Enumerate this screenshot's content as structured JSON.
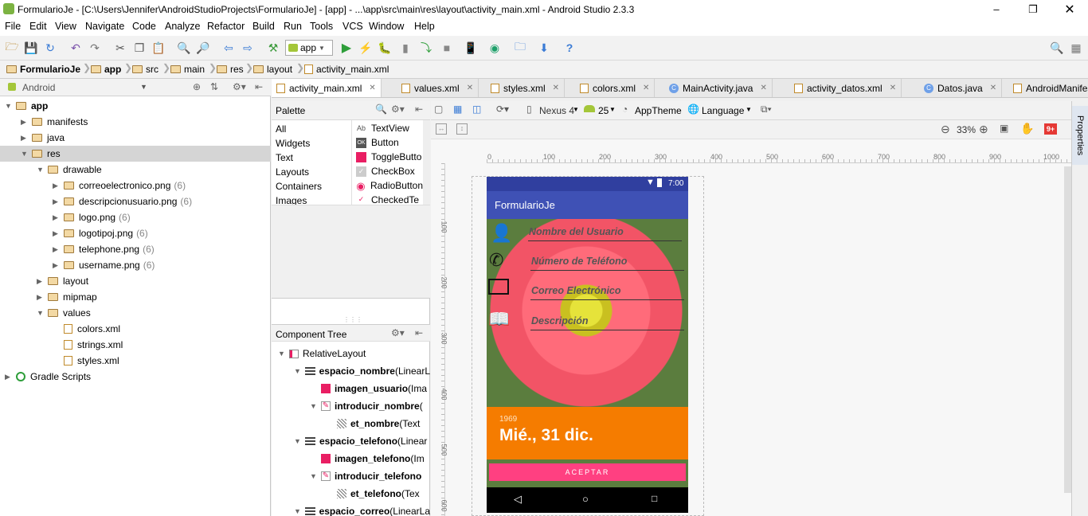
{
  "window": {
    "title": "FormularioJe - [C:\\Users\\Jennifer\\AndroidStudioProjects\\FormularioJe] - [app] - ...\\app\\src\\main\\res\\layout\\activity_main.xml - Android Studio 2.3.3"
  },
  "menu": [
    "File",
    "Edit",
    "View",
    "Navigate",
    "Code",
    "Analyze",
    "Refactor",
    "Build",
    "Run",
    "Tools",
    "VCS",
    "Window",
    "Help"
  ],
  "toolbar": {
    "run_config": "app"
  },
  "breadcrumb": [
    "FormularioJe",
    "app",
    "src",
    "main",
    "res",
    "layout",
    "activity_main.xml"
  ],
  "project": {
    "view_mode": "Android",
    "tree": [
      {
        "label": "app",
        "depth": 0,
        "bold": true,
        "type": "module",
        "expanded": true
      },
      {
        "label": "manifests",
        "depth": 1,
        "type": "folder",
        "arrow": "▶"
      },
      {
        "label": "java",
        "depth": 1,
        "type": "folder",
        "arrow": "▶"
      },
      {
        "label": "res",
        "depth": 1,
        "type": "folder",
        "arrow": "▼",
        "selected": true
      },
      {
        "label": "drawable",
        "depth": 2,
        "type": "folder",
        "arrow": "▼"
      },
      {
        "label": "correoelectronico.png",
        "depth": 3,
        "type": "folder",
        "arrow": "▶",
        "count": "(6)"
      },
      {
        "label": "descripcionusuario.png",
        "depth": 3,
        "type": "folder",
        "arrow": "▶",
        "count": "(6)"
      },
      {
        "label": "logo.png",
        "depth": 3,
        "type": "folder",
        "arrow": "▶",
        "count": "(6)"
      },
      {
        "label": "logotipoj.png",
        "depth": 3,
        "type": "folder",
        "arrow": "▶",
        "count": "(6)"
      },
      {
        "label": "telephone.png",
        "depth": 3,
        "type": "folder",
        "arrow": "▶",
        "count": "(6)"
      },
      {
        "label": "username.png",
        "depth": 3,
        "type": "folder",
        "arrow": "▶",
        "count": "(6)"
      },
      {
        "label": "layout",
        "depth": 2,
        "type": "folder",
        "arrow": "▶"
      },
      {
        "label": "mipmap",
        "depth": 2,
        "type": "folder",
        "arrow": "▶"
      },
      {
        "label": "values",
        "depth": 2,
        "type": "folder",
        "arrow": "▼"
      },
      {
        "label": "colors.xml",
        "depth": 3,
        "type": "file"
      },
      {
        "label": "strings.xml",
        "depth": 3,
        "type": "file"
      },
      {
        "label": "styles.xml",
        "depth": 3,
        "type": "file"
      },
      {
        "label": "Gradle Scripts",
        "depth": 0,
        "type": "gradle",
        "arrow": "▶"
      }
    ]
  },
  "tabs": [
    {
      "label": "activity_main.xml",
      "active": true,
      "icon": "layout-icon"
    },
    {
      "label": "values.xml",
      "icon": "xml-icon"
    },
    {
      "label": "styles.xml",
      "icon": "xml-icon"
    },
    {
      "label": "colors.xml",
      "icon": "xml-icon"
    },
    {
      "label": "MainActivity.java",
      "icon": "class-icon"
    },
    {
      "label": "activity_datos.xml",
      "icon": "layout-icon"
    },
    {
      "label": "Datos.java",
      "icon": "class-icon"
    },
    {
      "label": "AndroidManifest.xml",
      "icon": "manifest-icon"
    }
  ],
  "palette": {
    "title": "Palette",
    "categories": [
      "All",
      "Widgets",
      "Text",
      "Layouts",
      "Containers",
      "Images"
    ],
    "items": [
      {
        "label": "TextView",
        "icon": "Ab"
      },
      {
        "label": "Button",
        "icon": "OK"
      },
      {
        "label": "ToggleButto",
        "icon": "toggle"
      },
      {
        "label": "CheckBox",
        "icon": "check"
      },
      {
        "label": "RadioButton",
        "icon": "radio"
      },
      {
        "label": "CheckedTe",
        "icon": "checked"
      }
    ]
  },
  "component_tree": {
    "title": "Component Tree",
    "items": [
      {
        "label": "RelativeLayout",
        "suffix": "",
        "depth": 0,
        "icon": "relative"
      },
      {
        "label": "espacio_nombre",
        "suffix": " (LinearL",
        "depth": 1,
        "icon": "linear",
        "bold": true
      },
      {
        "label": "imagen_usuario",
        "suffix": " (Ima",
        "depth": 2,
        "icon": "image",
        "bold": true
      },
      {
        "label": "introducir_nombre",
        "suffix": " (",
        "depth": 2,
        "icon": "edit",
        "bold": true
      },
      {
        "label": "et_nombre",
        "suffix": " (Text",
        "depth": 3,
        "icon": "text",
        "bold": true
      },
      {
        "label": "espacio_telefono",
        "suffix": " (Linear",
        "depth": 1,
        "icon": "linear",
        "bold": true
      },
      {
        "label": "imagen_telefono",
        "suffix": " (Im",
        "depth": 2,
        "icon": "image",
        "bold": true
      },
      {
        "label": "introducir_telefono",
        "suffix": "",
        "depth": 2,
        "icon": "edit",
        "bold": true
      },
      {
        "label": "et_telefono",
        "suffix": " (Tex",
        "depth": 3,
        "icon": "text",
        "bold": true
      },
      {
        "label": "espacio_correo",
        "suffix": " (LinearLa",
        "depth": 1,
        "icon": "linear",
        "bold": true
      }
    ]
  },
  "design_toolbar": {
    "device": "Nexus 4",
    "api": "25",
    "theme": "AppTheme",
    "language": "Language",
    "zoom": "33%",
    "badge": "9+"
  },
  "ruler": {
    "h_ticks": [
      "0",
      "100",
      "200",
      "300",
      "400",
      "500",
      "600",
      "700",
      "800",
      "900",
      "1000"
    ],
    "v_ticks": [
      "100",
      "200",
      "300",
      "400",
      "500",
      "600"
    ]
  },
  "phone": {
    "status_time": "7:00",
    "app_title": "FormularioJe",
    "fields": [
      "Nombre del Usuario",
      "Número de Teléfono",
      "Correo Electrónico",
      "Descripción"
    ],
    "date_year": "1969",
    "date_text": "Mié., 31 dic.",
    "accept": "ACEPTAR",
    "colors": {
      "appbar": "#3f51b5",
      "statusbar": "#303f9f",
      "date_bg": "#f57c00",
      "button": "#ff4081"
    }
  },
  "sidebar": {
    "properties": "Properties"
  }
}
